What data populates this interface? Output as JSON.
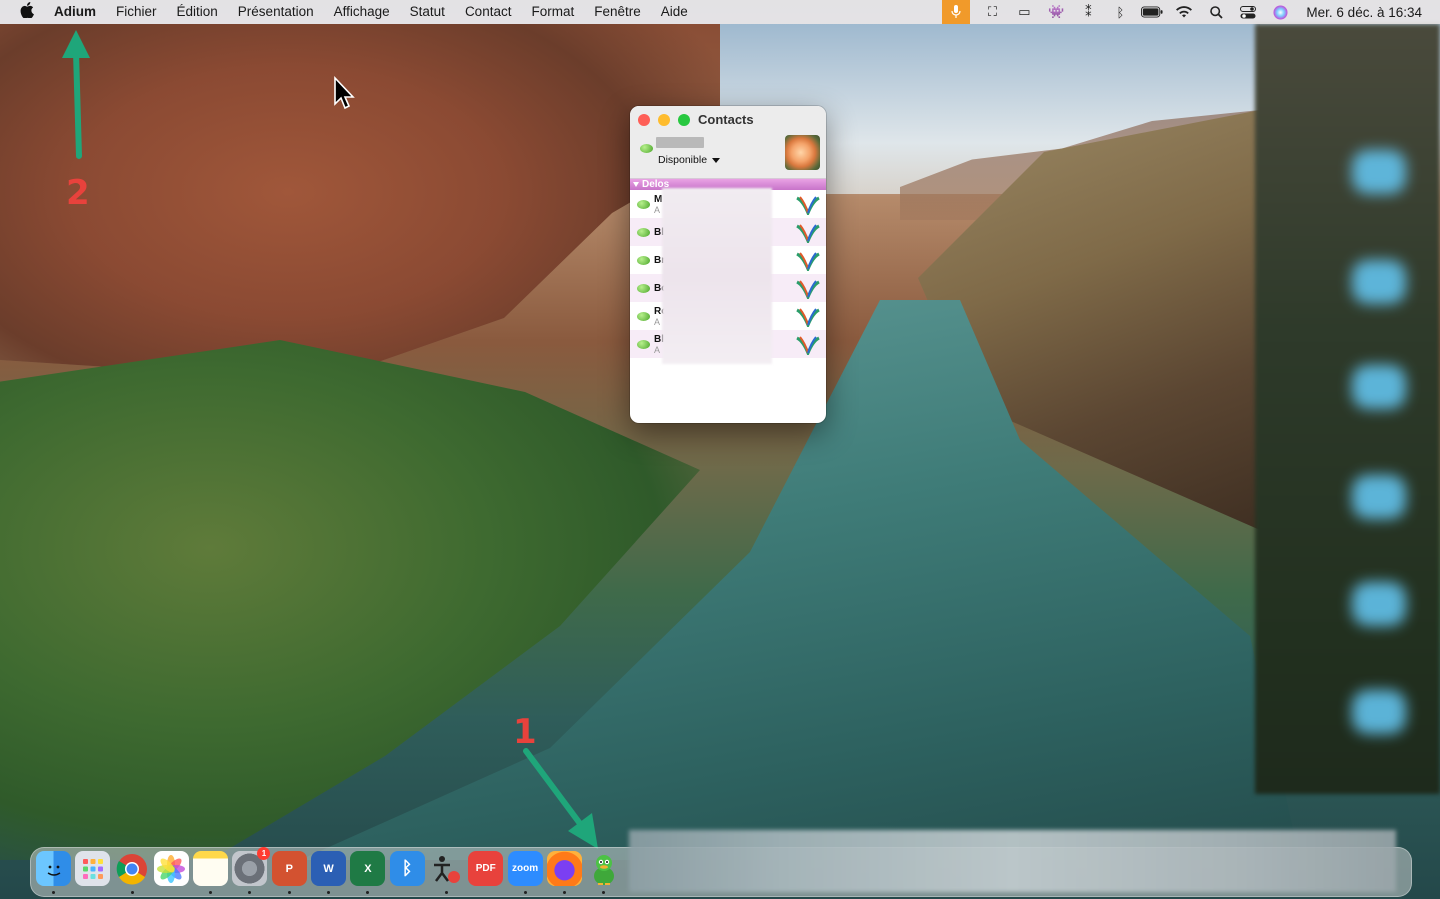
{
  "menubar": {
    "app_name": "Adium",
    "menus": [
      "Fichier",
      "Édition",
      "Présentation",
      "Affichage",
      "Statut",
      "Contact",
      "Format",
      "Fenêtre",
      "Aide"
    ],
    "clock": "Mer. 6 déc. à 16:34",
    "tray_icons": [
      "microphone-icon",
      "screen-capture-icon",
      "screen-mirroring-icon",
      "alien-icon",
      "airpods-icon",
      "bluetooth-icon",
      "battery-icon",
      "wifi-icon",
      "search-icon",
      "control-center-icon",
      "siri-icon"
    ],
    "mic_color": "#f19a2a"
  },
  "annotations": [
    {
      "label": "1",
      "color": "#e8423c",
      "arrow_color": "#1fa67a"
    },
    {
      "label": "2",
      "color": "#e8423c",
      "arrow_color": "#1fa67a"
    }
  ],
  "contacts_window": {
    "title": "Contacts",
    "status": "Disponible",
    "group": "Delos",
    "contacts": [
      {
        "name": "M",
        "sub": "A"
      },
      {
        "name": "Bl",
        "sub": ""
      },
      {
        "name": "Br",
        "sub": ""
      },
      {
        "name": "Bo",
        "sub": ""
      },
      {
        "name": "Ro",
        "sub": "A"
      },
      {
        "name": "Bl",
        "sub": "A"
      }
    ],
    "group_color": "#c774c9"
  },
  "dock": {
    "apps": [
      {
        "name": "Finder",
        "icon": "finder-icon"
      },
      {
        "name": "Launchpad",
        "icon": "launchpad-icon"
      },
      {
        "name": "Chrome",
        "icon": "chrome-icon"
      },
      {
        "name": "Photos",
        "icon": "photos-icon"
      },
      {
        "name": "Notes",
        "icon": "notes-icon"
      },
      {
        "name": "Préférences Système",
        "icon": "system-preferences-icon",
        "badge": "1"
      },
      {
        "name": "PowerPoint",
        "icon": "powerpoint-icon"
      },
      {
        "name": "Word",
        "icon": "word-icon"
      },
      {
        "name": "Excel",
        "icon": "excel-icon"
      },
      {
        "name": "Bluetooth",
        "icon": "bluetooth-icon"
      },
      {
        "name": "Accessibilité",
        "icon": "accessibility-icon"
      },
      {
        "name": "PDF",
        "icon": "pdf-icon"
      },
      {
        "name": "Zoom",
        "icon": "zoom-icon",
        "text": "zoom"
      },
      {
        "name": "Firefox",
        "icon": "firefox-icon"
      },
      {
        "name": "Adium",
        "icon": "adium-duck-icon"
      }
    ]
  }
}
